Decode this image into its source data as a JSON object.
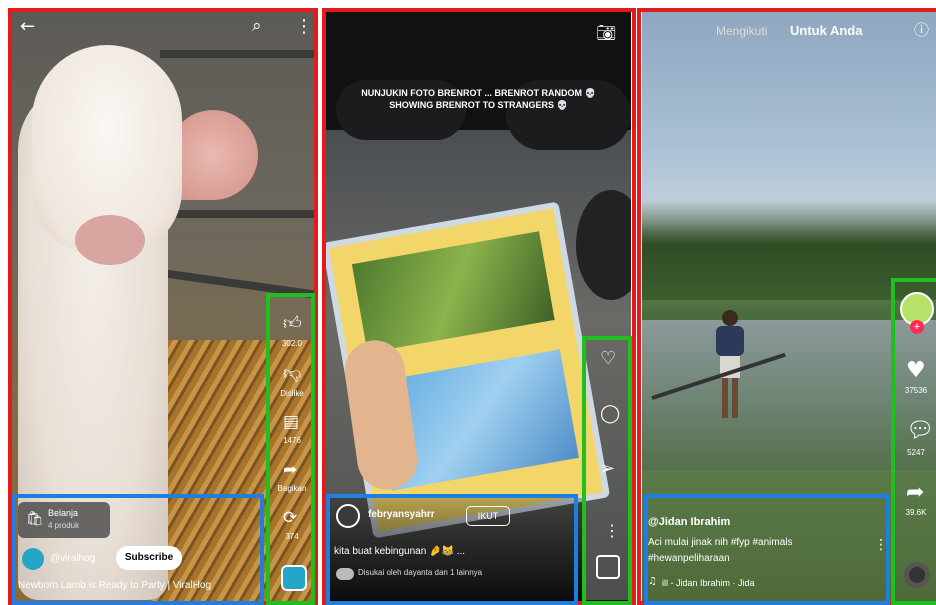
{
  "panel1": {
    "shop_label": "Belanja",
    "shop_sub": "4 produk",
    "username": "@viralhog",
    "subscribe_label": "Subscribe",
    "caption": "Newborn Lamb is Ready to Party | ViralHog",
    "like_count": "302.0",
    "dislike_count": "Dislike",
    "comment_count": "1476",
    "share_count": "Bagikan",
    "remix_count": "374"
  },
  "panel2": {
    "overlay_text_line1": "NUNJUKIN FOTO BRENROT ... BRENROT RANDOM 💀",
    "overlay_text_line2": "SHOWING BRENROT TO STRANGERS 💀",
    "username": "febryansyahrr",
    "follow_label": "IKUT",
    "caption": "kita buat kebingunan 🤌😹 ...",
    "liked_by": "Disukai oleh dayanta dan 1 lainnya"
  },
  "panel3": {
    "tab_following": "Mengikuti",
    "tab_for_you": "Untuk Anda",
    "username": "@Jidan Ibrahim",
    "caption_line1": "Aci mulai jinak nih #fyp #animals",
    "caption_line2": "#hewanpeliharaan",
    "sound": "ill - Jidan Ibrahim · Jida",
    "like_count": "37536",
    "comment_count": "5247",
    "share_count": "39.6K"
  },
  "colors": {
    "outline_red": "#e31b1b",
    "outline_green": "#1fbf1f",
    "outline_blue": "#1f7fe0",
    "accent_teal": "#24a6c8",
    "tiktok_red": "#fe2c55"
  }
}
